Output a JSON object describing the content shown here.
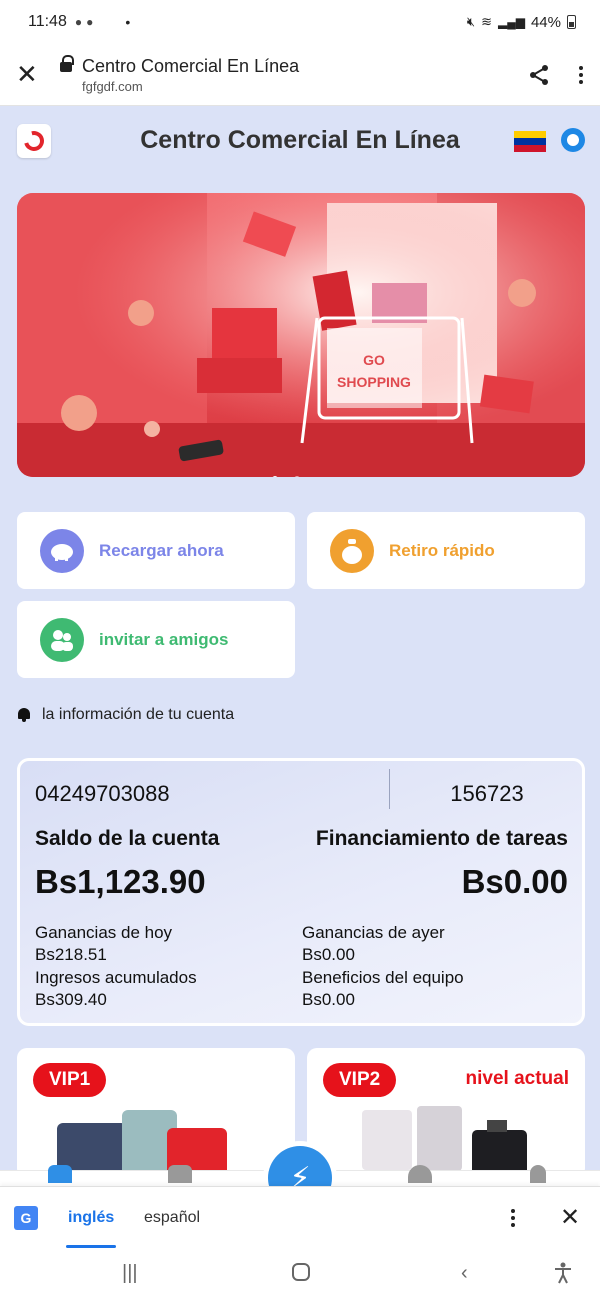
{
  "status": {
    "time": "11:48",
    "battery": "44%"
  },
  "browser": {
    "page_title": "Centro Comercial En Línea",
    "url": "fgfgdf.com"
  },
  "header": {
    "title": "Centro Comercial En Línea"
  },
  "banner": {
    "sign": "GO SHOPPING"
  },
  "actions": {
    "recharge": "Recargar ahora",
    "withdraw": "Retiro rápido",
    "invite": "invitar a amigos"
  },
  "notice": "la información de tu cuenta",
  "account": {
    "phone": "04249703088",
    "code": "156723",
    "balance_label": "Saldo de la cuenta",
    "balance": "Bs1,123.90",
    "task_label": "Financiamiento de tareas",
    "task_amount": "Bs0.00",
    "today_label": "Ganancias de hoy",
    "today_value": "Bs218.51",
    "accum_label": "Ingresos acumulados",
    "accum_value": "Bs309.40",
    "yesterday_label": "Ganancias de ayer",
    "yesterday_value": "Bs0.00",
    "team_label": "Beneficios del equipo",
    "team_value": "Bs0.00"
  },
  "vip": [
    {
      "badge": "VIP1",
      "level": ""
    },
    {
      "badge": "VIP2",
      "level": "nivel actual"
    }
  ],
  "translate": {
    "lang_active": "inglés",
    "lang_other": "español"
  },
  "colors": {
    "page_bg": "#dbe2f7",
    "recharge": "#7c85e8",
    "withdraw": "#f0a02f",
    "invite": "#3fba72",
    "vip_red": "#e6121b",
    "fab_blue": "#2f8fe6"
  }
}
